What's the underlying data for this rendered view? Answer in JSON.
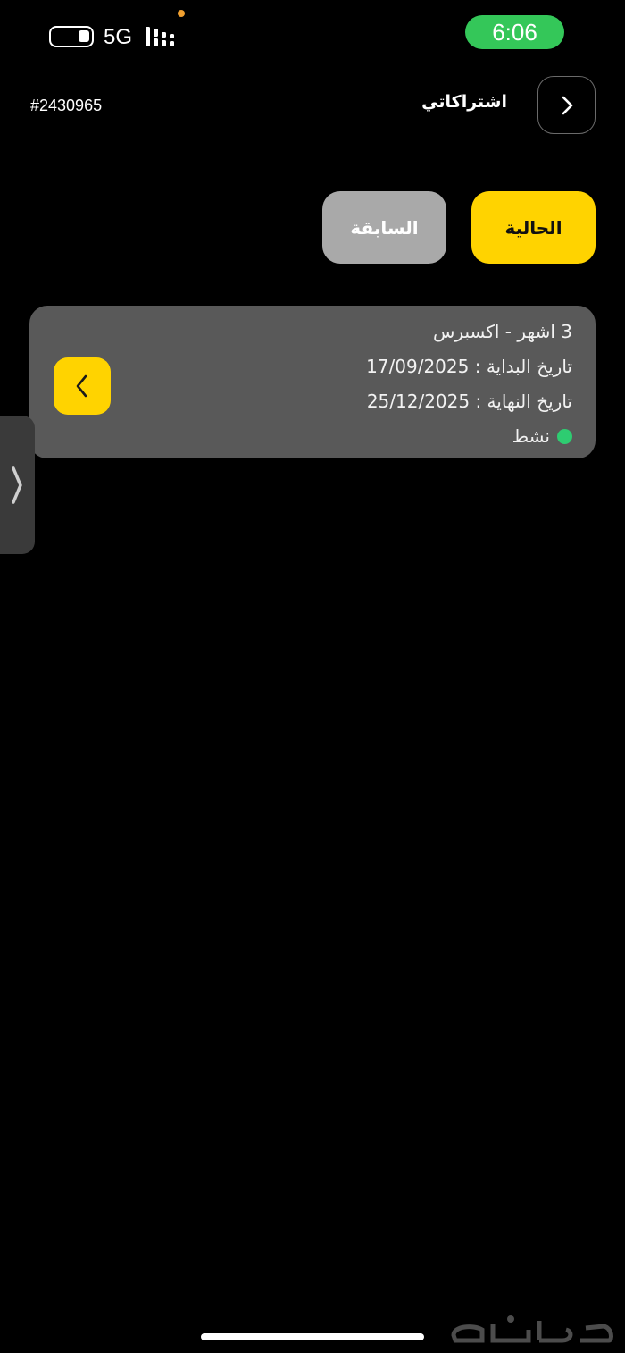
{
  "status_bar": {
    "time": "6:06",
    "network": "5G"
  },
  "header": {
    "title": "اشتراكاتي",
    "account_id": "#2430965"
  },
  "tabs": [
    {
      "label": "الحالية",
      "selected": true
    },
    {
      "label": "السابقة",
      "selected": false
    }
  ],
  "subscription": {
    "plan": "3 اشهر - اكسبرس",
    "start_date": "تاريخ البداية : 17/09/2025",
    "end_date": "تاريخ النهاية : 25/12/2025",
    "status": "نشط",
    "status_color": "#2ecc71"
  },
  "colors": {
    "accent": "#ffd300",
    "card": "#595959",
    "background": "#000000"
  },
  "icons": {
    "back": "chevron-right-icon",
    "card_open": "chevron-left-icon",
    "drawer": "chevron-right-icon"
  }
}
